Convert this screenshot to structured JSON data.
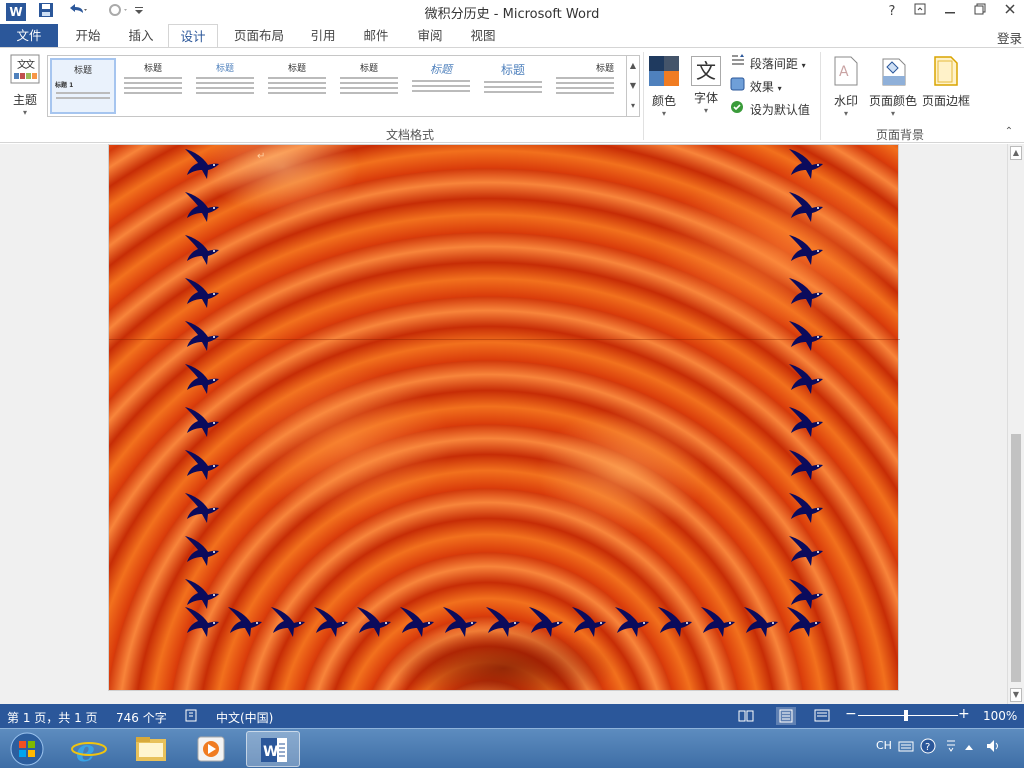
{
  "window": {
    "title": "微积分历史 - Microsoft Word",
    "app_icon": "W",
    "qat": {
      "save": "save-icon",
      "undo": "undo-icon",
      "redo": "redo-icon",
      "customize": "customize-qat-icon"
    },
    "controls": {
      "help": "?",
      "ribbon_display": "ribbon-display-icon",
      "minimize": "minimize-icon",
      "restore": "restore-icon",
      "close": "close-icon"
    }
  },
  "ribbon": {
    "tabs": [
      "文件",
      "开始",
      "插入",
      "设计",
      "页面布局",
      "引用",
      "邮件",
      "审阅",
      "视图"
    ],
    "active_tab": "设计",
    "login": "登录",
    "theme_button": "主题",
    "gallery_titles": [
      "标题",
      "标题",
      "标题",
      "标题",
      "标题",
      "标题",
      "标题",
      "标题",
      "标题"
    ],
    "gallery_first_heading": "标题 1",
    "colors_button": "颜色",
    "fonts_button": "字体",
    "fonts_glyph": "文",
    "paragraph_spacing": "段落间距",
    "effects": "效果",
    "set_default": "设为默认值",
    "watermark": "水印",
    "page_color": "页面颜色",
    "page_borders": "页面边框",
    "group_document_formatting": "文档格式",
    "group_page_background": "页面背景",
    "accent_color": "#2b579a"
  },
  "document": {
    "background": "orange-chrysanthemum-photo",
    "border_art": "blue-swallow-bird-border",
    "bird_color": "#0b0b5c"
  },
  "status": {
    "page": "第 1 页，共 1 页",
    "words": "746 个字",
    "language": "中文(中国)",
    "zoom": "100%",
    "zoom_minus": "−",
    "zoom_plus": "+"
  },
  "taskbar": {
    "items": [
      "start-orb",
      "internet-explorer",
      "file-explorer",
      "media-player",
      "microsoft-word"
    ],
    "active": "microsoft-word",
    "input_lang": "CH"
  }
}
